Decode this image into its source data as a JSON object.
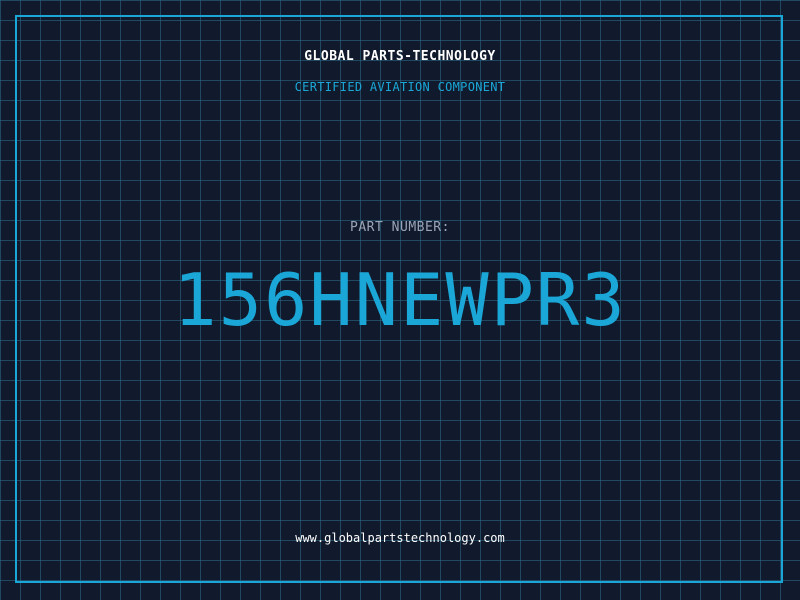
{
  "label": {
    "company": "GLOBAL PARTS-TECHNOLOGY",
    "subtitle": "CERTIFIED AVIATION COMPONENT",
    "part_number_label": "PART NUMBER:",
    "part_number": "156HNEWPR3",
    "website": "www.globalpartstechnology.com"
  },
  "colors": {
    "background": "#111a2c",
    "grid": "#2e6e8c",
    "accent": "#1aa7d8",
    "text_primary": "#ffffff",
    "text_muted": "#9aa6b8"
  }
}
